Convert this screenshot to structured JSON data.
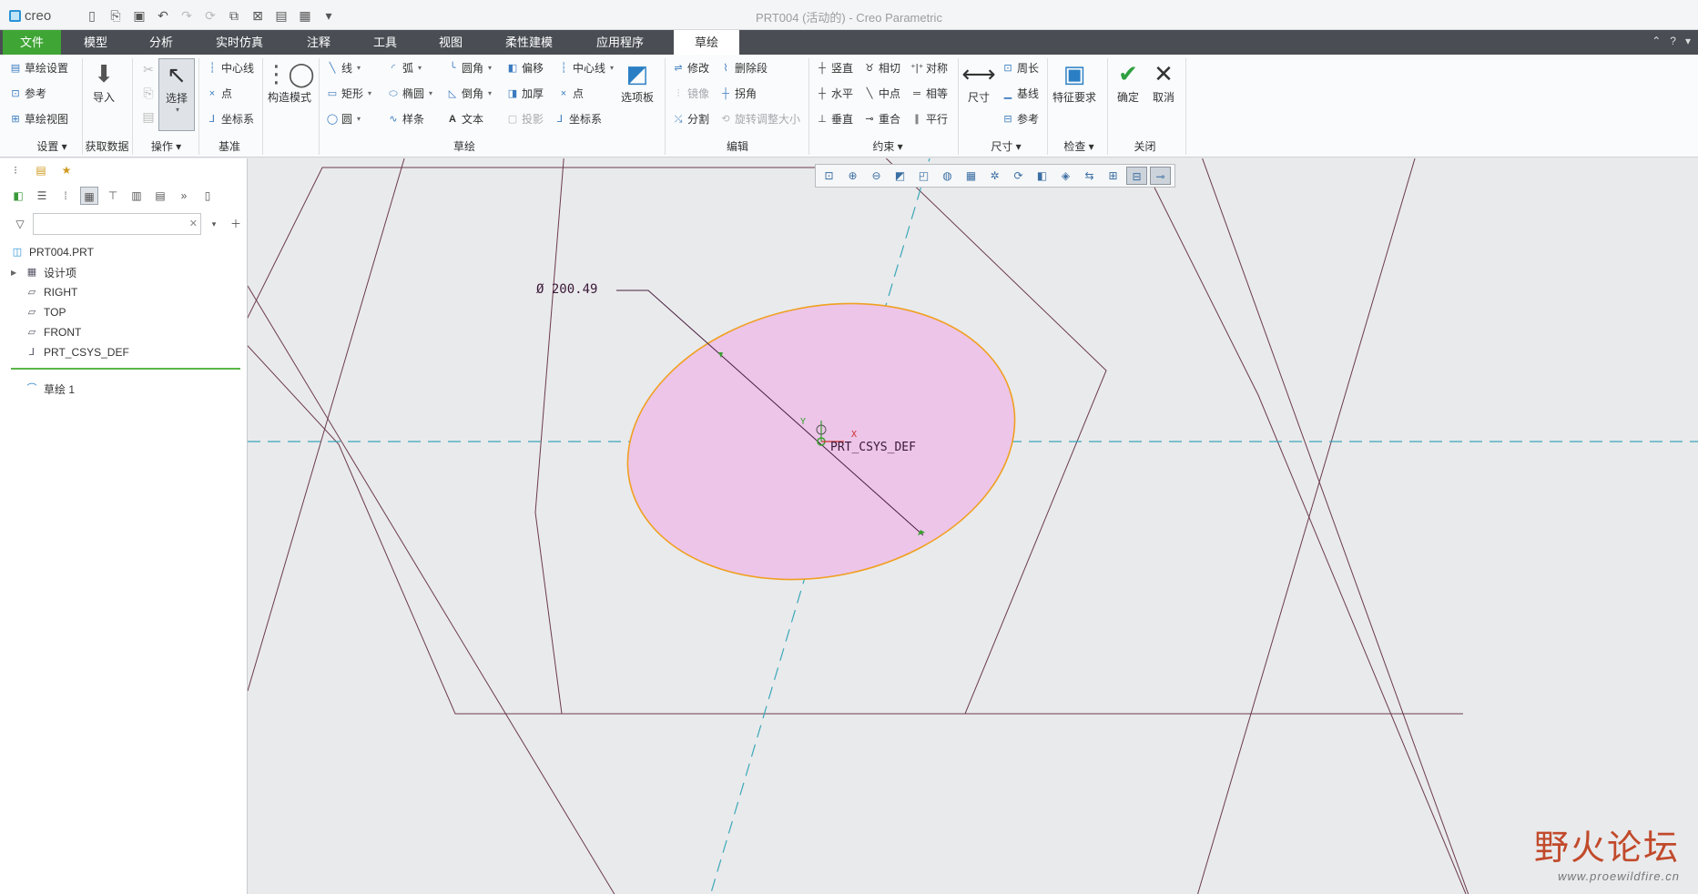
{
  "titlebar": {
    "logo": "creo",
    "title": "PRT004 (活动的) - Creo Parametric"
  },
  "tabs": {
    "file": "文件",
    "items": [
      "模型",
      "分析",
      "实时仿真",
      "注释",
      "工具",
      "视图",
      "柔性建模",
      "应用程序"
    ],
    "active": "草绘"
  },
  "ribbon": {
    "setup": {
      "sketch_setup": "草绘设置",
      "references": "参考",
      "sketch_view": "草绘视图",
      "label": "设置"
    },
    "get_data": {
      "import": "导入",
      "label": "获取数据"
    },
    "operations": {
      "select": "选择",
      "label": "操作"
    },
    "datum": {
      "centerline": "中心线",
      "point": "点",
      "csys": "坐标系",
      "label": "基准"
    },
    "construction": {
      "mode": "构造模式"
    },
    "sketching": {
      "line": "线",
      "arc": "弧",
      "fillet": "圆角",
      "offset": "偏移",
      "centerline": "中心线",
      "rectangle": "矩形",
      "ellipse": "椭圆",
      "chamfer": "倒角",
      "thicken": "加厚",
      "point": "点",
      "circle": "圆",
      "spline": "样条",
      "text": "文本",
      "project": "投影",
      "csys": "坐标系",
      "palette": "选项板",
      "label": "草绘"
    },
    "editing": {
      "modify": "修改",
      "delete_segment": "删除段",
      "mirror": "镜像",
      "corner": "拐角",
      "divide": "分割",
      "rotate_resize": "旋转调整大小",
      "label": "编辑"
    },
    "constrain": {
      "vertical": "竖直",
      "tangent": "相切",
      "symmetric": "对称",
      "horizontal": "水平",
      "midpoint": "中点",
      "equal": "相等",
      "perpendicular": "垂直",
      "coincident": "重合",
      "parallel": "平行",
      "label": "约束"
    },
    "dimension": {
      "dimension": "尺寸",
      "perimeter": "周长",
      "baseline": "基线",
      "reference": "参考",
      "label": "尺寸"
    },
    "inspect": {
      "feature_req": "特征要求",
      "label": "检查"
    },
    "close": {
      "ok": "确定",
      "cancel": "取消",
      "label": "关闭"
    }
  },
  "model_tree": {
    "filter_placeholder": "",
    "items": [
      "PRT004.PRT",
      "设计项",
      "RIGHT",
      "TOP",
      "FRONT",
      "PRT_CSYS_DEF"
    ],
    "sketch_item": "草绘 1"
  },
  "canvas": {
    "dimension_label": "Ø 200.49",
    "csys_label": "PRT_CSYS_DEF",
    "axis_x": "X",
    "axis_y": "Y",
    "ellipse_fill": "#ecc5e8",
    "ellipse_stroke": "#f0a020",
    "centerline_color": "#3aa8b8",
    "geometry_color": "#6b3b4a"
  },
  "watermark": {
    "text": "野火论坛",
    "url": "www.proewildfire.cn"
  }
}
